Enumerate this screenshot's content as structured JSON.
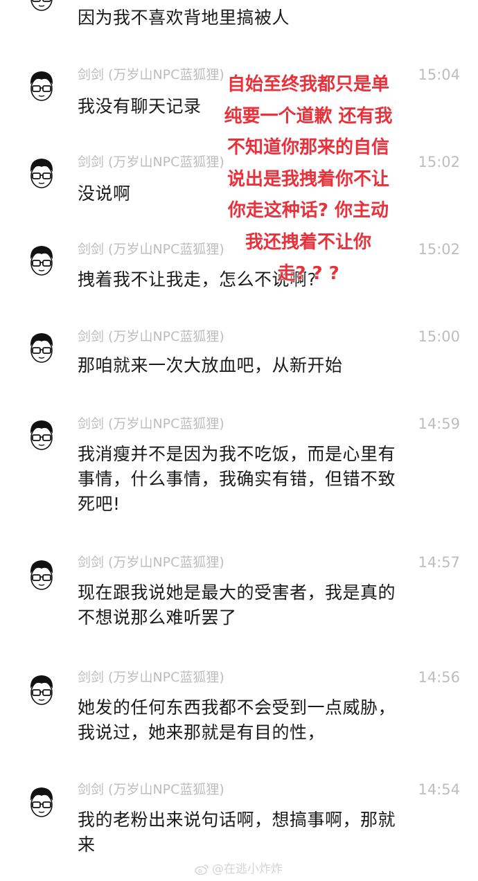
{
  "messages": [
    {
      "sender": "",
      "time": "",
      "text": "因为我不喜欢背地里搞被人"
    },
    {
      "sender": "剑剑 (万岁山NPC蓝狐狸)",
      "time": "15:04",
      "text": "我没有聊天记录"
    },
    {
      "sender": "剑剑 (万岁山NPC蓝狐狸)",
      "time": "15:02",
      "text": "没说啊"
    },
    {
      "sender": "剑剑 (万岁山NPC蓝狐狸)",
      "time": "15:02",
      "text": "拽着我不让我走，怎么不说啊?"
    },
    {
      "sender": "剑剑 (万岁山NPC蓝狐狸)",
      "time": "15:00",
      "text": "那咱就来一次大放血吧，从新开始"
    },
    {
      "sender": "剑剑 (万岁山NPC蓝狐狸)",
      "time": "14:59",
      "text": "我消瘦并不是因为我不吃饭，而是心里有\n事情，什么事情，我确实有错，但错不致\n死吧!"
    },
    {
      "sender": "剑剑 (万岁山NPC蓝狐狸)",
      "time": "14:57",
      "text": "现在跟我说她是最大的受害者，我是真的\n不想说那么难听罢了"
    },
    {
      "sender": "剑剑 (万岁山NPC蓝狐狸)",
      "time": "14:56",
      "text": "她发的任何东西我都不会受到一点威胁，\n我说过，她来那就是有目的性，"
    },
    {
      "sender": "剑剑 (万岁山NPC蓝狐狸)",
      "time": "14:54",
      "text": "我的老粉出来说句话啊，想搞事啊，那就\n来"
    }
  ],
  "overlay_text": "自始至终我都只是单\n纯要一个道歉 还有我\n不知道你那来的自信\n说出是我拽着你不让\n你走这种话? 你主动\n我还拽着不让你\n走? ? ?",
  "watermark": "@在逃小炸炸",
  "colors": {
    "meta": "#bdbdbd",
    "body_text": "#1a1a1a",
    "overlay": "#e8313b"
  },
  "icons": {
    "avatar": "cartoon-boy-glasses-icon",
    "watermark": "weibo-logo-icon"
  }
}
